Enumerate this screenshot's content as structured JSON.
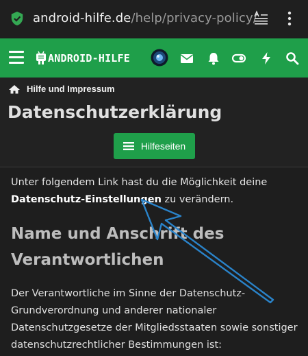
{
  "browser": {
    "url_host": "android-hilfe.de",
    "url_path": "/help/privacy-policy/",
    "reader_icon": "reader-mode-icon",
    "menu_icon": "kebab-menu-icon",
    "secure_icon": "shield-check-icon",
    "secure_color": "#34a853"
  },
  "site": {
    "brand_color": "#1f9f4a",
    "logo_text": "ANDROID-HILFE",
    "nav_icons": [
      "menu-icon",
      "envelope-icon",
      "bell-icon",
      "toggle-icon",
      "bolt-icon",
      "search-icon"
    ]
  },
  "breadcrumb": {
    "label": "Hilfe und Impressum"
  },
  "page": {
    "title": "Datenschutzerklärung",
    "help_button": "Hilfeseiten"
  },
  "content": {
    "intro_before": "Unter folgendem Link hast du die Möglichkeit deine ",
    "intro_link": "Datenschutz-Einstellungen",
    "intro_after": " zu verändern.",
    "section_title": "Name und Anschrift des Verantwortlichen",
    "paragraph": "Der Verantwortliche im Sinne der Datenschutz-Grundverordnung und anderer nationaler Datenschutzgesetze der Mitgliedsstaaten sowie sonstiger datenschutzrechtlicher Bestimmungen ist:"
  },
  "annotation": {
    "arrow_color": "#2a83c9"
  }
}
